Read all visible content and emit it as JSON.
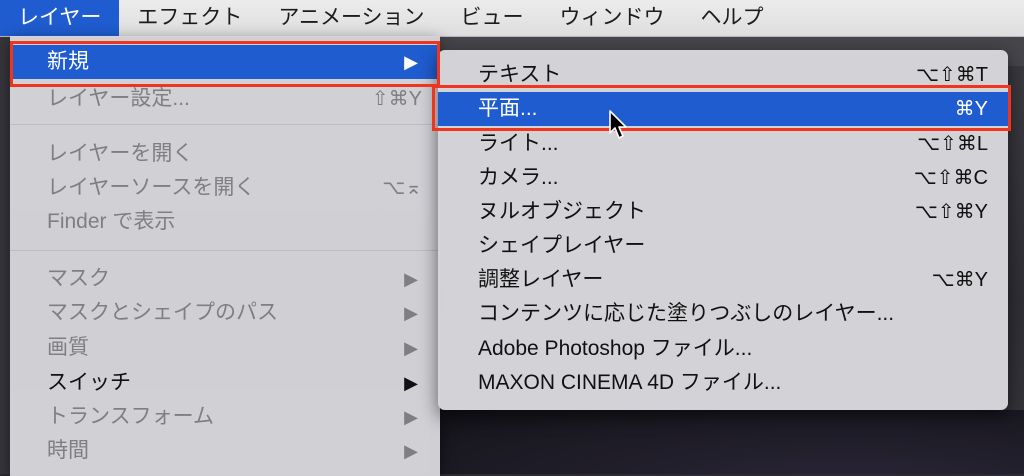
{
  "menubar": {
    "items": [
      {
        "label": "レイヤー",
        "active": true
      },
      {
        "label": "エフェクト",
        "active": false
      },
      {
        "label": "アニメーション",
        "active": false
      },
      {
        "label": "ビュー",
        "active": false
      },
      {
        "label": "ウィンドウ",
        "active": false
      },
      {
        "label": "ヘルプ",
        "active": false
      }
    ]
  },
  "layer_menu": {
    "new": {
      "label": "新規"
    },
    "layer_settings": {
      "label": "レイヤー設定...",
      "shortcut": "⇧⌘Y"
    },
    "open_layer": {
      "label": "レイヤーを開く"
    },
    "open_layer_source": {
      "label": "レイヤーソースを開く",
      "shortcut": "⌥⌅"
    },
    "show_in_finder": {
      "label": "Finder で表示"
    },
    "mask": {
      "label": "マスク"
    },
    "mask_shape_path": {
      "label": "マスクとシェイプのパス"
    },
    "quality": {
      "label": "画質"
    },
    "switches": {
      "label": "スイッチ"
    },
    "transform": {
      "label": "トランスフォーム"
    },
    "time": {
      "label": "時間"
    }
  },
  "new_submenu": {
    "text": {
      "label": "テキスト",
      "shortcut": "⌥⇧⌘T"
    },
    "solid": {
      "label": "平面...",
      "shortcut": "⌘Y"
    },
    "light": {
      "label": "ライト...",
      "shortcut": "⌥⇧⌘L"
    },
    "camera": {
      "label": "カメラ...",
      "shortcut": "⌥⇧⌘C"
    },
    "null_object": {
      "label": "ヌルオブジェクト",
      "shortcut": "⌥⇧⌘Y"
    },
    "shape_layer": {
      "label": "シェイプレイヤー"
    },
    "adjustment_layer": {
      "label": "調整レイヤー",
      "shortcut": "⌥⌘Y"
    },
    "content_aware_fill": {
      "label": "コンテンツに応じた塗りつぶしのレイヤー..."
    },
    "photoshop_file": {
      "label": "Adobe Photoshop ファイル..."
    },
    "cinema4d_file": {
      "label": "MAXON CINEMA 4D ファイル..."
    }
  },
  "icons": {
    "submenu_arrow": "▶",
    "cursor": "arrow-cursor-icon"
  },
  "colors": {
    "highlight": "#1f5ccf",
    "annotation": "#f0351f",
    "menu_bg": "#d6d6da"
  }
}
